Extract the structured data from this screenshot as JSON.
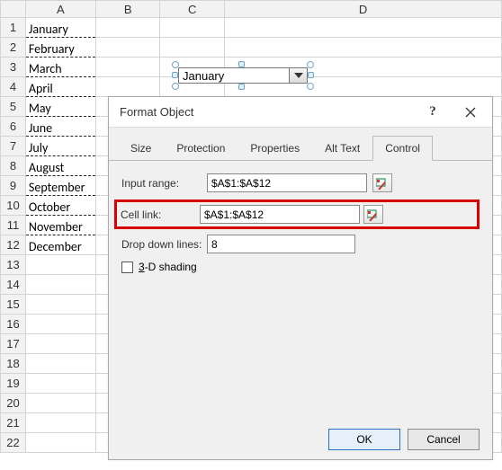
{
  "columns": [
    "A",
    "B",
    "C",
    "D"
  ],
  "row_numbers": [
    "1",
    "2",
    "3",
    "4",
    "5",
    "6",
    "7",
    "8",
    "9",
    "10",
    "11",
    "12",
    "13",
    "14",
    "15",
    "16",
    "17",
    "18",
    "19",
    "20",
    "21",
    "22"
  ],
  "cells_a": [
    "January",
    "February",
    "March",
    "April",
    "May",
    "June",
    "July",
    "August",
    "September",
    "October",
    "November",
    "December"
  ],
  "combo": {
    "value": "January"
  },
  "dialog": {
    "title": "Format Object",
    "help": "?",
    "tabs": [
      "Size",
      "Protection",
      "Properties",
      "Alt Text",
      "Control"
    ],
    "active_tab": 4,
    "control": {
      "input_range_label": "Input range:",
      "input_range_value": "$A$1:$A$12",
      "cell_link_label": "Cell link:",
      "cell_link_value": "$A$1:$A$12",
      "dropdown_lines_label": "Drop down lines:",
      "dropdown_lines_value": "8",
      "shading_label": "3-D shading"
    },
    "buttons": {
      "ok": "OK",
      "cancel": "Cancel"
    }
  }
}
